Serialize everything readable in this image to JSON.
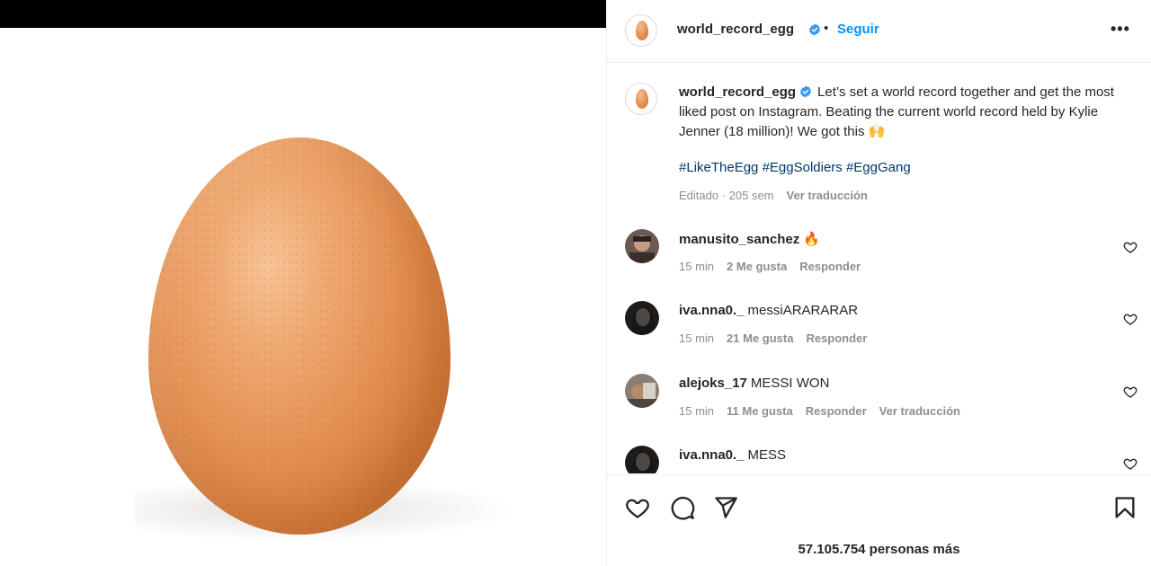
{
  "post": {
    "author": "world_record_egg",
    "follow_label": "Seguir",
    "separator": "•",
    "more_label": "•••"
  },
  "caption": {
    "username": "world_record_egg",
    "text": "Let’s set a world record together and get the most liked post on Instagram. Beating the current world record held by Kylie Jenner (18 million)! We got this 🙌",
    "hashtags": "#LikeTheEgg #EggSoldiers #EggGang",
    "edited": "Editado · 205 sem",
    "translate": "Ver traducción"
  },
  "comments": [
    {
      "username": "manusito_sanchez",
      "text": "🔥",
      "time": "15 min",
      "likes": "2 Me gusta",
      "reply": "Responder",
      "translate": ""
    },
    {
      "username": "iva.nna0._",
      "text": "messiARARARAR",
      "time": "15 min",
      "likes": "21 Me gusta",
      "reply": "Responder",
      "translate": ""
    },
    {
      "username": "alejoks_17",
      "text": "MESSI WON",
      "time": "15 min",
      "likes": "11 Me gusta",
      "reply": "Responder",
      "translate": "Ver traducción"
    },
    {
      "username": "iva.nna0._",
      "text": "MESS",
      "time": "",
      "likes": "",
      "reply": "",
      "translate": ""
    }
  ],
  "likes_text": "57.105.754 personas más",
  "colors": {
    "accent": "#0095f6",
    "hashtag": "#00376b",
    "muted": "#8e8e8e",
    "verified": "#3897f0"
  }
}
